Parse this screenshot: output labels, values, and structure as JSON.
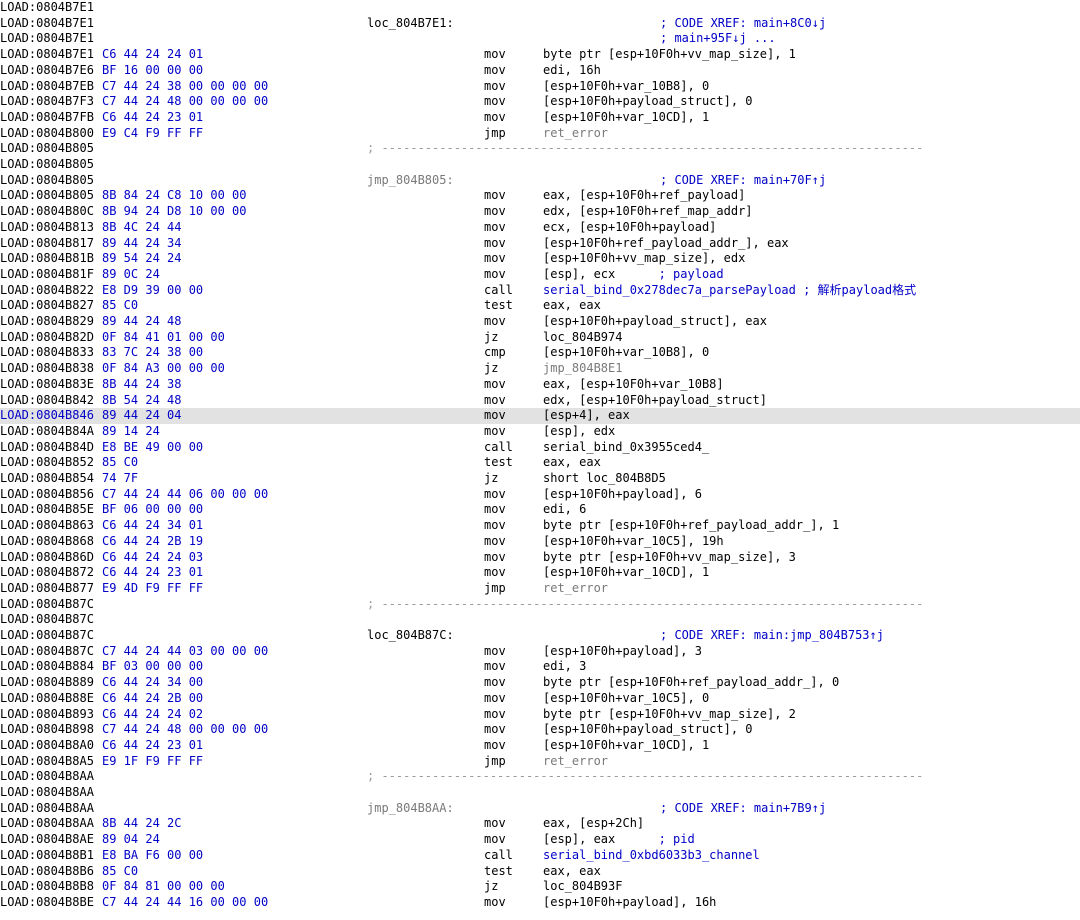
{
  "lines": [
    {
      "addr": "LOAD:0804B7E1"
    },
    {
      "addr": "LOAD:0804B7E1",
      "label": "loc_804B7E1:",
      "xref": "; CODE XREF: main+8C0↓j"
    },
    {
      "addr": "LOAD:0804B7E1",
      "xref": "; main+95F↓j ..."
    },
    {
      "addr": "LOAD:0804B7E1",
      "bytes": "C6 44 24 24 01",
      "mnem": "mov",
      "ops": "byte ptr [esp+10F0h+vv_map_size], 1"
    },
    {
      "addr": "LOAD:0804B7E6",
      "bytes": "BF 16 00 00 00",
      "mnem": "mov",
      "ops": "edi, 16h"
    },
    {
      "addr": "LOAD:0804B7EB",
      "bytes": "C7 44 24 38 00 00 00 00",
      "mnem": "mov",
      "ops": "[esp+10F0h+var_10B8], 0"
    },
    {
      "addr": "LOAD:0804B7F3",
      "bytes": "C7 44 24 48 00 00 00 00",
      "mnem": "mov",
      "ops": "[esp+10F0h+payload_struct], 0"
    },
    {
      "addr": "LOAD:0804B7FB",
      "bytes": "C6 44 24 23 01",
      "mnem": "mov",
      "ops": "[esp+10F0h+var_10CD], 1"
    },
    {
      "addr": "LOAD:0804B800",
      "bytes": "E9 C4 F9 FF FF",
      "mnem": "jmp",
      "ops": "ret_error",
      "opsStyle": "grey"
    },
    {
      "addr": "LOAD:0804B805",
      "sep": "; ---------------------------------------------------------------------------"
    },
    {
      "addr": "LOAD:0804B805"
    },
    {
      "addr": "LOAD:0804B805",
      "label": "jmp_804B805:",
      "labelStyle": "grey",
      "xref": "; CODE XREF: main+70F↑j"
    },
    {
      "addr": "LOAD:0804B805",
      "bytes": "8B 84 24 C8 10 00 00",
      "mnem": "mov",
      "ops": "eax, [esp+10F0h+ref_payload]"
    },
    {
      "addr": "LOAD:0804B80C",
      "bytes": "8B 94 24 D8 10 00 00",
      "mnem": "mov",
      "ops": "edx, [esp+10F0h+ref_map_addr]"
    },
    {
      "addr": "LOAD:0804B813",
      "bytes": "8B 4C 24 44",
      "mnem": "mov",
      "ops": "ecx, [esp+10F0h+payload]"
    },
    {
      "addr": "LOAD:0804B817",
      "bytes": "89 44 24 34",
      "mnem": "mov",
      "ops": "[esp+10F0h+ref_payload_addr_], eax"
    },
    {
      "addr": "LOAD:0804B81B",
      "bytes": "89 54 24 24",
      "mnem": "mov",
      "ops": "[esp+10F0h+vv_map_size], edx"
    },
    {
      "addr": "LOAD:0804B81F",
      "bytes": "89 0C 24",
      "mnem": "mov",
      "ops": "[esp], ecx      ",
      "comment": "; payload"
    },
    {
      "addr": "LOAD:0804B822",
      "bytes": "E8 D9 39 00 00",
      "mnem": "call",
      "ops": "serial_bind_0x278dec7a_parsePayload ",
      "opsStyle": "blue",
      "comment": "; 解析payload格式"
    },
    {
      "addr": "LOAD:0804B827",
      "bytes": "85 C0",
      "mnem": "test",
      "ops": "eax, eax"
    },
    {
      "addr": "LOAD:0804B829",
      "bytes": "89 44 24 48",
      "mnem": "mov",
      "ops": "[esp+10F0h+payload_struct], eax"
    },
    {
      "addr": "LOAD:0804B82D",
      "bytes": "0F 84 41 01 00 00",
      "mnem": "jz",
      "ops": "loc_804B974"
    },
    {
      "addr": "LOAD:0804B833",
      "bytes": "83 7C 24 38 00",
      "mnem": "cmp",
      "ops": "[esp+10F0h+var_10B8], 0"
    },
    {
      "addr": "LOAD:0804B838",
      "bytes": "0F 84 A3 00 00 00",
      "mnem": "jz",
      "ops": "jmp_804B8E1",
      "opsStyle": "grey"
    },
    {
      "addr": "LOAD:0804B83E",
      "bytes": "8B 44 24 38",
      "mnem": "mov",
      "ops": "eax, [esp+10F0h+var_10B8]"
    },
    {
      "addr": "LOAD:0804B842",
      "bytes": "8B 54 24 48",
      "mnem": "mov",
      "ops": "edx, [esp+10F0h+payload_struct]"
    },
    {
      "addr": "LOAD:0804B846",
      "bytes": "89 44 24 04",
      "mnem": "mov",
      "ops": "[esp+4], eax",
      "current": true
    },
    {
      "addr": "LOAD:0804B84A",
      "bytes": "89 14 24",
      "mnem": "mov",
      "ops": "[esp], edx"
    },
    {
      "addr": "LOAD:0804B84D",
      "bytes": "E8 BE 49 00 00",
      "mnem": "call",
      "ops": "serial_bind_0x3955ced4_"
    },
    {
      "addr": "LOAD:0804B852",
      "bytes": "85 C0",
      "mnem": "test",
      "ops": "eax, eax"
    },
    {
      "addr": "LOAD:0804B854",
      "bytes": "74 7F",
      "mnem": "jz",
      "ops": "short loc_804B8D5"
    },
    {
      "addr": "LOAD:0804B856",
      "bytes": "C7 44 24 44 06 00 00 00",
      "mnem": "mov",
      "ops": "[esp+10F0h+payload], 6"
    },
    {
      "addr": "LOAD:0804B85E",
      "bytes": "BF 06 00 00 00",
      "mnem": "mov",
      "ops": "edi, 6"
    },
    {
      "addr": "LOAD:0804B863",
      "bytes": "C6 44 24 34 01",
      "mnem": "mov",
      "ops": "byte ptr [esp+10F0h+ref_payload_addr_], 1"
    },
    {
      "addr": "LOAD:0804B868",
      "bytes": "C6 44 24 2B 19",
      "mnem": "mov",
      "ops": "[esp+10F0h+var_10C5], 19h"
    },
    {
      "addr": "LOAD:0804B86D",
      "bytes": "C6 44 24 24 03",
      "mnem": "mov",
      "ops": "byte ptr [esp+10F0h+vv_map_size], 3"
    },
    {
      "addr": "LOAD:0804B872",
      "bytes": "C6 44 24 23 01",
      "mnem": "mov",
      "ops": "[esp+10F0h+var_10CD], 1"
    },
    {
      "addr": "LOAD:0804B877",
      "bytes": "E9 4D F9 FF FF",
      "mnem": "jmp",
      "ops": "ret_error",
      "opsStyle": "grey"
    },
    {
      "addr": "LOAD:0804B87C",
      "sep": "; ---------------------------------------------------------------------------"
    },
    {
      "addr": "LOAD:0804B87C"
    },
    {
      "addr": "LOAD:0804B87C",
      "label": "loc_804B87C:",
      "xref": "; CODE XREF: main:jmp_804B753↑j"
    },
    {
      "addr": "LOAD:0804B87C",
      "bytes": "C7 44 24 44 03 00 00 00",
      "mnem": "mov",
      "ops": "[esp+10F0h+payload], 3"
    },
    {
      "addr": "LOAD:0804B884",
      "bytes": "BF 03 00 00 00",
      "mnem": "mov",
      "ops": "edi, 3"
    },
    {
      "addr": "LOAD:0804B889",
      "bytes": "C6 44 24 34 00",
      "mnem": "mov",
      "ops": "byte ptr [esp+10F0h+ref_payload_addr_], 0"
    },
    {
      "addr": "LOAD:0804B88E",
      "bytes": "C6 44 24 2B 00",
      "mnem": "mov",
      "ops": "[esp+10F0h+var_10C5], 0"
    },
    {
      "addr": "LOAD:0804B893",
      "bytes": "C6 44 24 24 02",
      "mnem": "mov",
      "ops": "byte ptr [esp+10F0h+vv_map_size], 2"
    },
    {
      "addr": "LOAD:0804B898",
      "bytes": "C7 44 24 48 00 00 00 00",
      "mnem": "mov",
      "ops": "[esp+10F0h+payload_struct], 0"
    },
    {
      "addr": "LOAD:0804B8A0",
      "bytes": "C6 44 24 23 01",
      "mnem": "mov",
      "ops": "[esp+10F0h+var_10CD], 1"
    },
    {
      "addr": "LOAD:0804B8A5",
      "bytes": "E9 1F F9 FF FF",
      "mnem": "jmp",
      "ops": "ret_error",
      "opsStyle": "grey"
    },
    {
      "addr": "LOAD:0804B8AA",
      "sep": "; ---------------------------------------------------------------------------"
    },
    {
      "addr": "LOAD:0804B8AA"
    },
    {
      "addr": "LOAD:0804B8AA",
      "label": "jmp_804B8AA:",
      "labelStyle": "grey",
      "xref": "; CODE XREF: main+7B9↑j"
    },
    {
      "addr": "LOAD:0804B8AA",
      "bytes": "8B 44 24 2C",
      "mnem": "mov",
      "ops": "eax, [esp+2Ch]"
    },
    {
      "addr": "LOAD:0804B8AE",
      "bytes": "89 04 24",
      "mnem": "mov",
      "ops": "[esp], eax      ",
      "comment": "; pid"
    },
    {
      "addr": "LOAD:0804B8B1",
      "bytes": "E8 BA F6 00 00",
      "mnem": "call",
      "ops": "serial_bind_0xbd6033b3_channel",
      "opsStyle": "blue"
    },
    {
      "addr": "LOAD:0804B8B6",
      "bytes": "85 C0",
      "mnem": "test",
      "ops": "eax, eax"
    },
    {
      "addr": "LOAD:0804B8B8",
      "bytes": "0F 84 81 00 00 00",
      "mnem": "jz",
      "ops": "loc_804B93F"
    },
    {
      "addr": "LOAD:0804B8BE",
      "bytes": "C7 44 24 44 16 00 00 00",
      "mnem": "mov",
      "ops": "[esp+10F0h+payload], 16h"
    }
  ]
}
